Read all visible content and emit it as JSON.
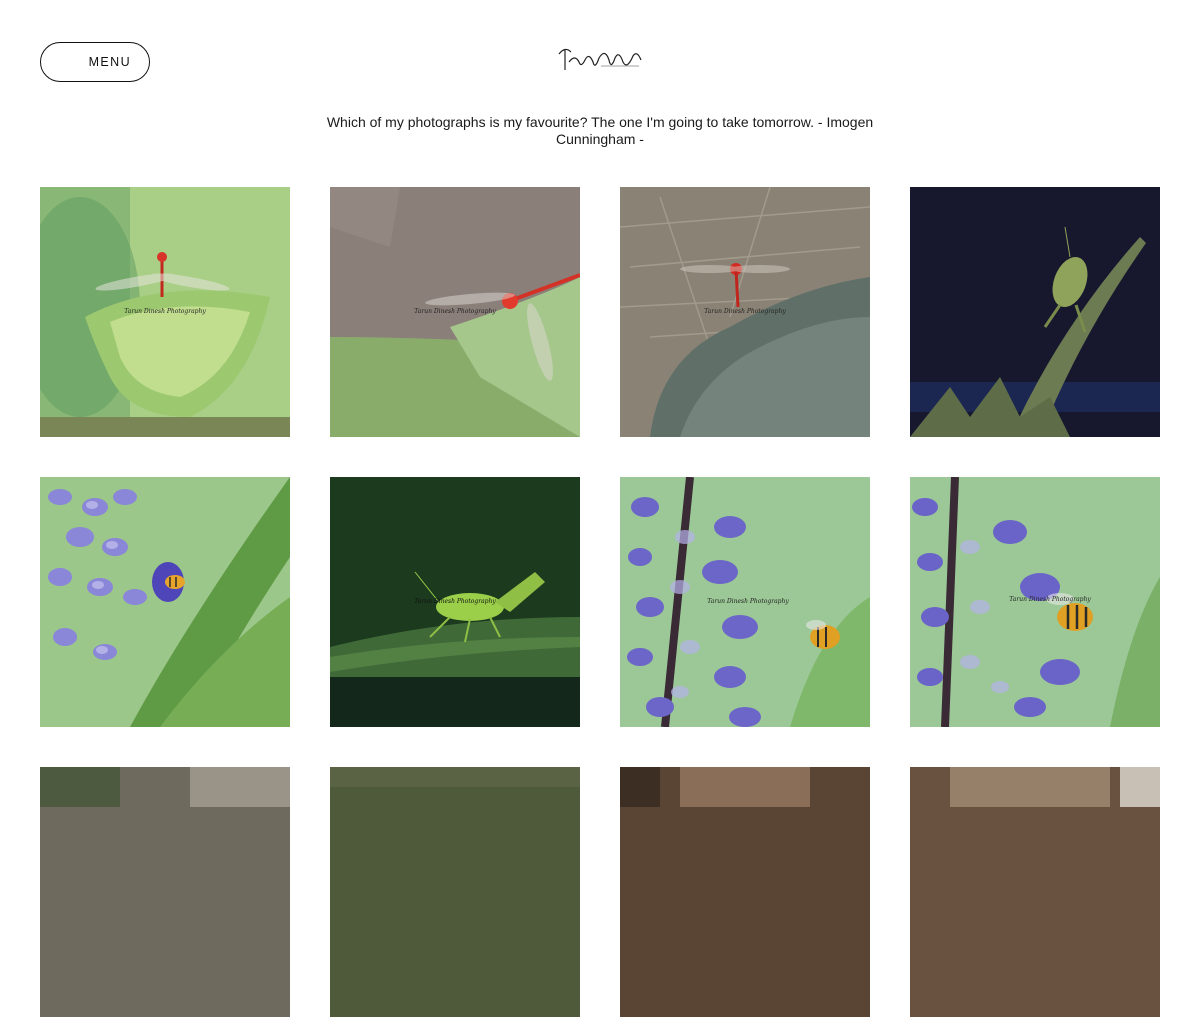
{
  "header": {
    "menu_label": "MENU",
    "logo_text": "Tarun Dinesh Photography"
  },
  "quote": {
    "text": "Which of my photographs is my favourite? The one I'm going to take tomorrow. - Imogen Cunningham -"
  },
  "gallery": {
    "watermark_text": "Tarun Dinesh Photography",
    "tiles": [
      {
        "subject": "red-dragonfly-on-green-leaf",
        "bg": "#8fbf6a",
        "accent": "#d8342a"
      },
      {
        "subject": "red-dragonfly-on-leaf-tip",
        "bg": "#8a7d77",
        "accent": "#e23a2c"
      },
      {
        "subject": "red-dragonfly-on-rock",
        "bg": "#7b756c",
        "accent": "#d42a22"
      },
      {
        "subject": "grasshopper-on-dark-background",
        "bg": "#16162e",
        "accent": "#8fa35a"
      },
      {
        "subject": "bee-on-purple-flowers",
        "bg": "#8cbf7a",
        "accent": "#6a62c8"
      },
      {
        "subject": "green-grasshopper-on-leaf",
        "bg": "#1d3a1f",
        "accent": "#8fbf45"
      },
      {
        "subject": "bee-flying-near-purple-flowers",
        "bg": "#93c48e",
        "accent": "#5d55c0"
      },
      {
        "subject": "bee-on-purple-flower-spike",
        "bg": "#8fc28a",
        "accent": "#5a52bd"
      },
      {
        "subject": "partial-photo-grey",
        "bg": "#6f6a5e",
        "accent": "#9a9488"
      },
      {
        "subject": "partial-photo-green",
        "bg": "#4f5a3a",
        "accent": "#6d7650"
      },
      {
        "subject": "partial-photo-brown",
        "bg": "#5a4434",
        "accent": "#8a6e58"
      },
      {
        "subject": "partial-photo-brown-2",
        "bg": "#6a5240",
        "accent": "#96806a"
      }
    ]
  }
}
